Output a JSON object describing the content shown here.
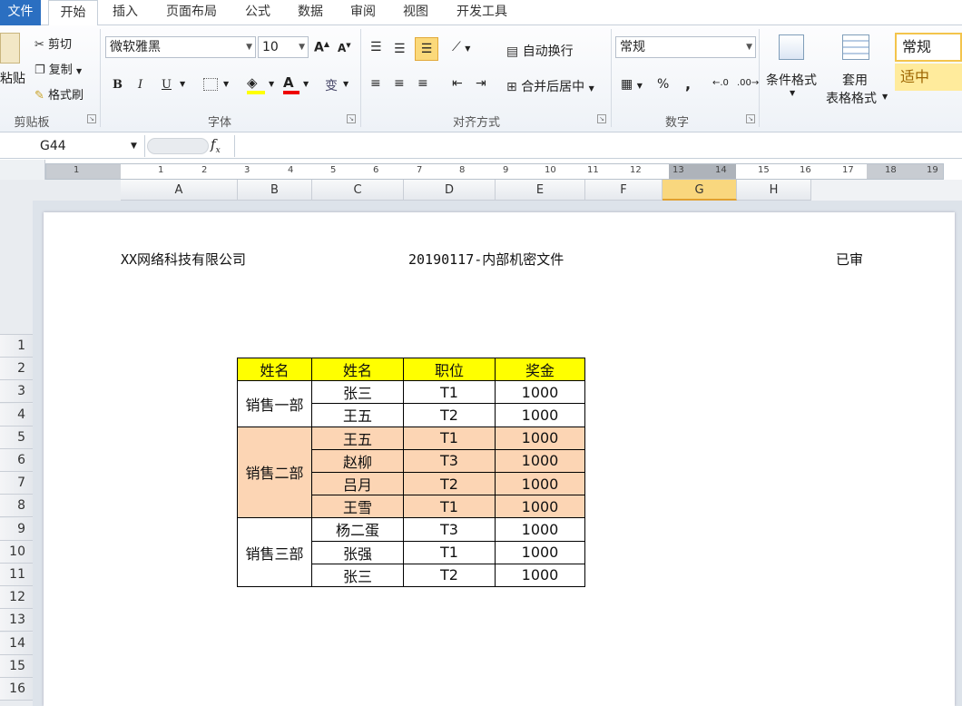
{
  "tabs": {
    "file": "文件",
    "home": "开始",
    "insert": "插入",
    "page_layout": "页面布局",
    "formulas": "公式",
    "data": "数据",
    "review": "审阅",
    "view": "视图",
    "developer": "开发工具"
  },
  "clipboard": {
    "paste": "粘贴",
    "cut": "剪切",
    "copy": "复制",
    "format_painter": "格式刷",
    "label": "剪贴板"
  },
  "font": {
    "name": "微软雅黑",
    "size": "10",
    "label": "字体",
    "bold": "B",
    "italic": "I",
    "underline": "U"
  },
  "alignment": {
    "wrap_text": "自动换行",
    "merge_center": "合并后居中",
    "label": "对齐方式"
  },
  "number": {
    "format": "常规",
    "percent": "%",
    "comma": ",",
    "label": "数字"
  },
  "styles": {
    "conditional": "条件格式",
    "table_format_1": "套用",
    "table_format_2": "表格格式",
    "style_normal": "常规",
    "style_neutral": "适中"
  },
  "formula_bar": {
    "name_box": "G44",
    "fx": "fx"
  },
  "ruler_numbers": [
    "1",
    "1",
    "2",
    "3",
    "4",
    "5",
    "6",
    "7",
    "8",
    "9",
    "10",
    "11",
    "12",
    "13",
    "14",
    "15",
    "16",
    "17",
    "18",
    "19"
  ],
  "columns": [
    "A",
    "B",
    "C",
    "D",
    "E",
    "F",
    "G",
    "H"
  ],
  "rows": [
    "1",
    "2",
    "3",
    "4",
    "5",
    "6",
    "7",
    "8",
    "9",
    "10",
    "11",
    "12",
    "13",
    "14",
    "15",
    "16"
  ],
  "page_header": {
    "left": "XX网络科技有限公司",
    "center": "20190117-内部机密文件",
    "right": "已审"
  },
  "table": {
    "headers": [
      "姓名",
      "姓名",
      "职位",
      "奖金"
    ],
    "groups": [
      {
        "dept": "销售一部",
        "rows": [
          [
            "张三",
            "T1",
            "1000"
          ],
          [
            "王五",
            "T2",
            "1000"
          ]
        ]
      },
      {
        "dept": "销售二部",
        "rows": [
          [
            "王五",
            "T1",
            "1000"
          ],
          [
            "赵柳",
            "T3",
            "1000"
          ],
          [
            "吕月",
            "T2",
            "1000"
          ],
          [
            "王雪",
            "T1",
            "1000"
          ]
        ]
      },
      {
        "dept": "销售三部",
        "rows": [
          [
            "杨二蛋",
            "T3",
            "1000"
          ],
          [
            "张强",
            "T1",
            "1000"
          ],
          [
            "张三",
            "T2",
            "1000"
          ]
        ]
      }
    ]
  },
  "colors": {
    "header_yellow": "#ffff00",
    "group_peach": "#fcd5b4",
    "selected_col": "#f9d77e",
    "file_tab": "#2b6fc1"
  }
}
